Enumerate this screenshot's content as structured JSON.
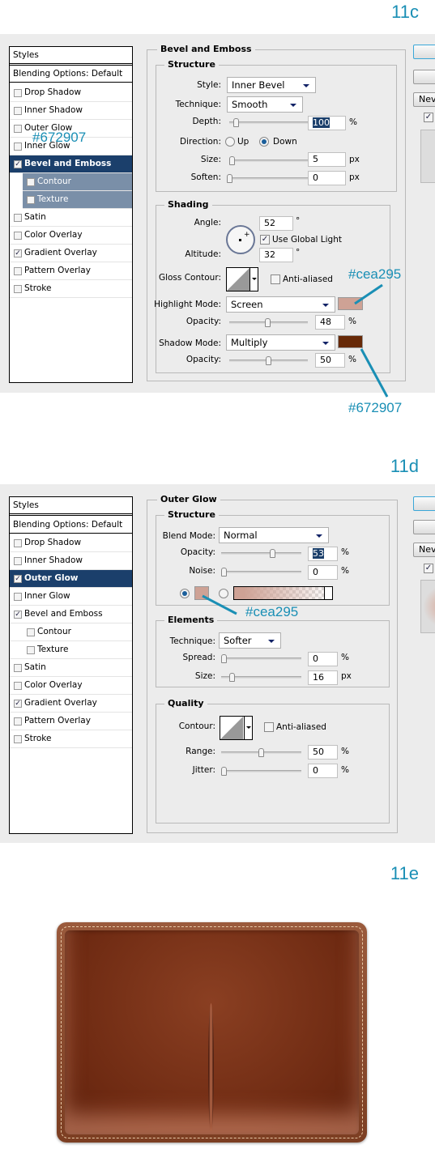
{
  "steps": {
    "c": "11c",
    "d": "11d",
    "e": "11e"
  },
  "colors": {
    "accent": "#1a8fb5",
    "highlight": "#cea295",
    "shadow": "#672907",
    "selected": "#1b3f6b"
  },
  "panel_c": {
    "styles_header": "Styles",
    "blending": "Blending Options: Default",
    "items": [
      {
        "label": "Drop Shadow",
        "checked": false
      },
      {
        "label": "Inner Shadow",
        "checked": false
      },
      {
        "label": "Outer Glow",
        "checked": false
      },
      {
        "label": "Inner Glow",
        "checked": false
      },
      {
        "label": "Bevel and Emboss",
        "checked": true,
        "selected": true
      },
      {
        "label": "Contour",
        "checked": false
      },
      {
        "label": "Texture",
        "checked": false
      },
      {
        "label": "Satin",
        "checked": false
      },
      {
        "label": "Color Overlay",
        "checked": false
      },
      {
        "label": "Gradient Overlay",
        "checked": true
      },
      {
        "label": "Pattern Overlay",
        "checked": false
      },
      {
        "label": "Stroke",
        "checked": false
      }
    ],
    "group_title": "Bevel and Emboss",
    "structure": {
      "title": "Structure",
      "style_label": "Style:",
      "style_value": "Inner Bevel",
      "technique_label": "Technique:",
      "technique_value": "Smooth",
      "depth_label": "Depth:",
      "depth_value": "100",
      "depth_unit": "%",
      "direction_label": "Direction:",
      "direction_up": "Up",
      "direction_down": "Down",
      "direction_selected": "Down",
      "size_label": "Size:",
      "size_value": "5",
      "size_unit": "px",
      "soften_label": "Soften:",
      "soften_value": "0",
      "soften_unit": "px"
    },
    "shading": {
      "title": "Shading",
      "angle_label": "Angle:",
      "angle_value": "52",
      "deg": "°",
      "global_light": "Use Global Light",
      "global_light_checked": true,
      "altitude_label": "Altitude:",
      "altitude_value": "32",
      "gloss_label": "Gloss Contour:",
      "anti_aliased": "Anti-aliased",
      "highlight_label": "Highlight Mode:",
      "highlight_value": "Screen",
      "highlight_opacity_label": "Opacity:",
      "highlight_opacity": "48",
      "pct": "%",
      "shadow_label": "Shadow Mode:",
      "shadow_value": "Multiply",
      "shadow_opacity_label": "Opacity:",
      "shadow_opacity": "50"
    },
    "annotations": {
      "highlight": "#cea295",
      "shadow": "#672907",
      "overlay": "#672907"
    },
    "side_new": "Nev"
  },
  "panel_d": {
    "styles_header": "Styles",
    "blending": "Blending Options: Default",
    "items": [
      {
        "label": "Drop Shadow",
        "checked": false
      },
      {
        "label": "Inner Shadow",
        "checked": false
      },
      {
        "label": "Outer Glow",
        "checked": true,
        "selected": true
      },
      {
        "label": "Inner Glow",
        "checked": false
      },
      {
        "label": "Bevel and Emboss",
        "checked": true
      },
      {
        "label": "Contour",
        "checked": false
      },
      {
        "label": "Texture",
        "checked": false
      },
      {
        "label": "Satin",
        "checked": false
      },
      {
        "label": "Color Overlay",
        "checked": false
      },
      {
        "label": "Gradient Overlay",
        "checked": true
      },
      {
        "label": "Pattern Overlay",
        "checked": false
      },
      {
        "label": "Stroke",
        "checked": false
      }
    ],
    "group_title": "Outer Glow",
    "structure": {
      "title": "Structure",
      "blend_label": "Blend Mode:",
      "blend_value": "Normal",
      "opacity_label": "Opacity:",
      "opacity_value": "53",
      "pct": "%",
      "noise_label": "Noise:",
      "noise_value": "0"
    },
    "elements": {
      "title": "Elements",
      "technique_label": "Technique:",
      "technique_value": "Softer",
      "spread_label": "Spread:",
      "spread_value": "0",
      "pct": "%",
      "size_label": "Size:",
      "size_value": "16",
      "px": "px"
    },
    "quality": {
      "title": "Quality",
      "contour_label": "Contour:",
      "anti_aliased": "Anti-aliased",
      "range_label": "Range:",
      "range_value": "50",
      "pct": "%",
      "jitter_label": "Jitter:",
      "jitter_value": "0"
    },
    "annotations": {
      "glow": "#cea295"
    },
    "side_new": "Nev"
  }
}
